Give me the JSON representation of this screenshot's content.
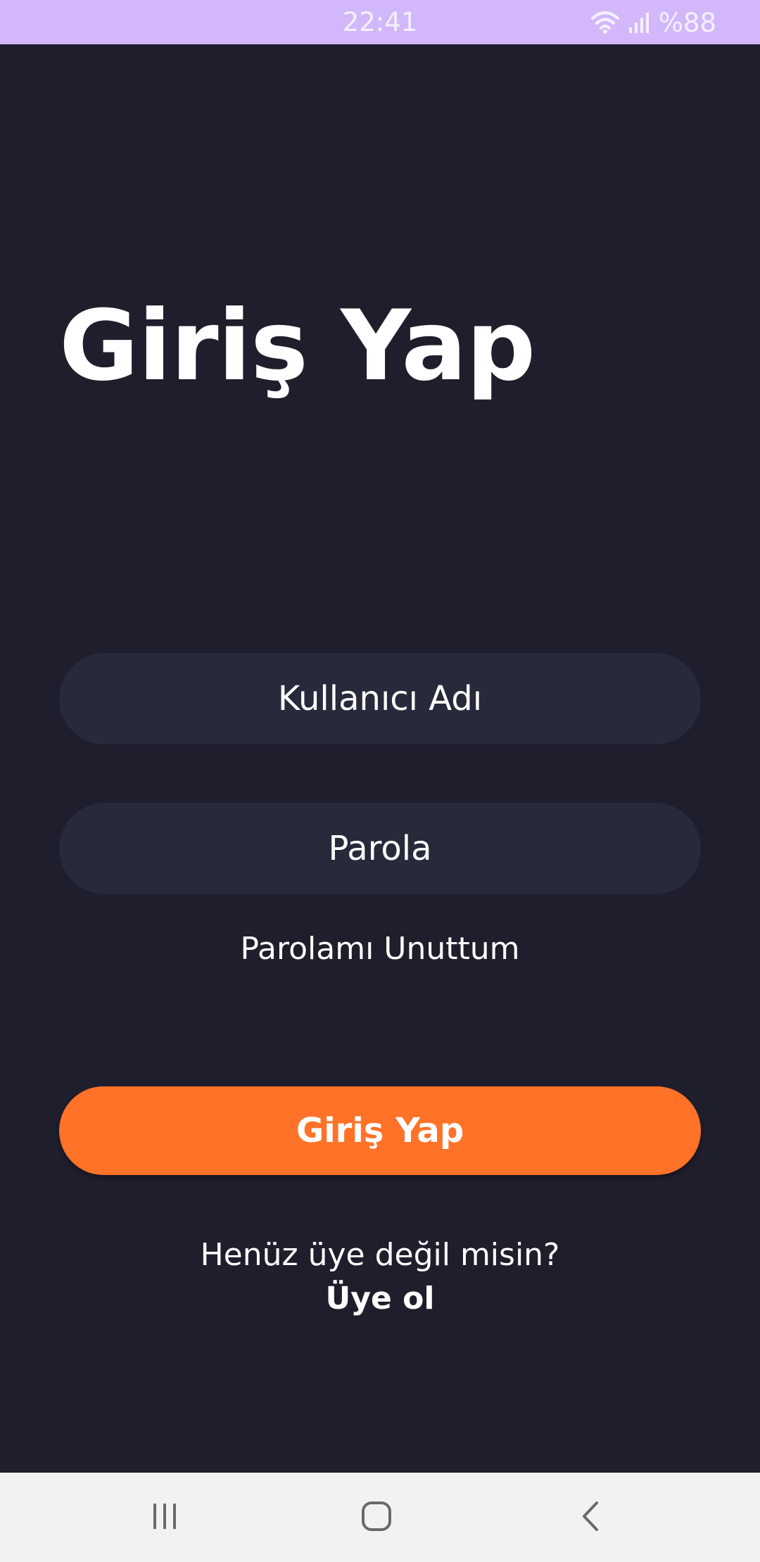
{
  "status_bar": {
    "time": "22:41",
    "battery": "%88",
    "icons": [
      "wifi-icon",
      "signal-icon"
    ]
  },
  "login": {
    "title": "Giriş Yap",
    "username_placeholder": "Kullanıcı Adı",
    "password_placeholder": "Parola",
    "forgot_password": "Parolamı Unuttum",
    "submit_label": "Giriş Yap",
    "signup_prompt": "Henüz üye değil misin?",
    "signup_link": "Üye ol"
  },
  "nav_bar": {
    "icons": [
      "recent-apps-icon",
      "home-icon",
      "back-icon"
    ]
  },
  "colors": {
    "background": "#1f1e2c",
    "field": "#272a3a",
    "accent": "#ff7228",
    "status_bar": "#d2b8fb",
    "nav_bar": "#f2f2f2"
  }
}
